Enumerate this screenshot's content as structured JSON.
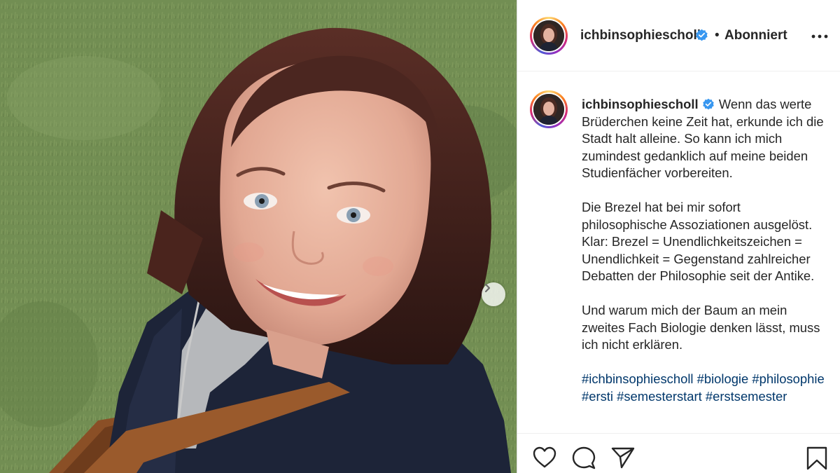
{
  "post": {
    "username": "ichbinsophiescholl",
    "separator": "•",
    "follow_status": "Abonniert",
    "caption": {
      "username": "ichbinsophiescholl",
      "paragraph_1": "Wenn das werte Brüderchen keine Zeit hat, erkunde ich die Stadt halt alleine. So kann ich mich zumindest gedanklich auf meine beiden Studienfächer vorbereiten.",
      "paragraph_2": "Die Brezel hat bei mir sofort philosophische Assoziationen ausgelöst. Klar: Brezel = Unendlichkeitszeichen = Unendlichkeit = Gegenstand zahlreicher Debatten der Philosophie seit der Antike.",
      "paragraph_3": "Und warum mich der Baum an mein zweites Fach Biologie denken lässt, muss ich nicht erklären.",
      "hashtags": [
        "#ichbinsophiescholl",
        "#biologie",
        "#philosophie",
        "#ersti",
        "#semesterstart",
        "#erstsemester"
      ]
    }
  },
  "icons": {
    "verified": "verified-badge-icon",
    "more": "more-options-icon",
    "next": "chevron-right-icon",
    "like": "heart-icon",
    "comment": "comment-bubble-icon",
    "share": "paper-plane-icon",
    "save": "bookmark-icon"
  },
  "colors": {
    "text": "#262626",
    "hashtag": "#00376b",
    "verified": "#3897f0",
    "border": "#dbdbdb"
  }
}
